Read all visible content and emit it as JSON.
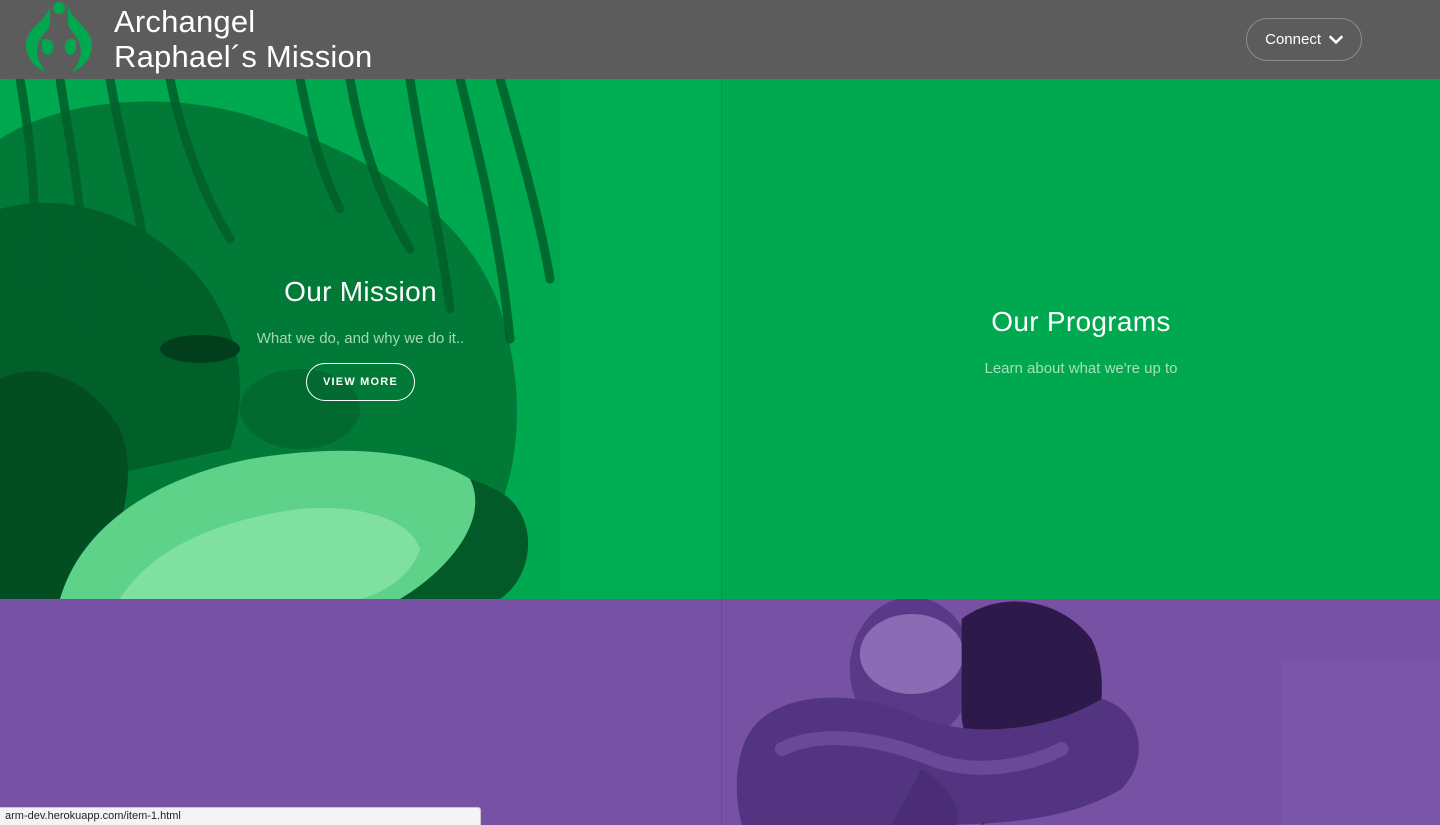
{
  "header": {
    "brand_line1": "Archangel",
    "brand_line2": "Raphael´s Mission",
    "logo_icon": "leaf-circle-logo",
    "connect_label": "Connect",
    "connect_icon": "chevron-down-icon"
  },
  "panels": {
    "mission": {
      "title": "Our Mission",
      "subtitle": "What we do, and why we do it..",
      "button_label": "VIEW MORE",
      "image": "person-eating-bread-photo"
    },
    "programs": {
      "title": "Our Programs",
      "subtitle": "Learn about what we're up to"
    },
    "purple_right": {
      "image": "two-people-hugging-photo"
    }
  },
  "status_bar": {
    "url": "arm-dev.herokuapp.com/item-1.html"
  },
  "colors": {
    "header_bg": "#5c5c5c",
    "brand_green": "#00a84f",
    "brand_purple": "#7651a4",
    "text_white": "#ffffff"
  }
}
